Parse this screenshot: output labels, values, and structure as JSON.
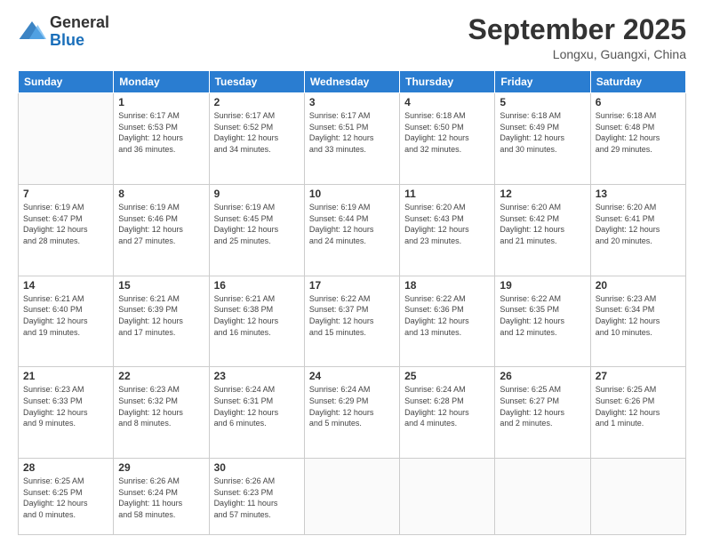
{
  "logo": {
    "general": "General",
    "blue": "Blue"
  },
  "header": {
    "month": "September 2025",
    "location": "Longxu, Guangxi, China"
  },
  "weekdays": [
    "Sunday",
    "Monday",
    "Tuesday",
    "Wednesday",
    "Thursday",
    "Friday",
    "Saturday"
  ],
  "weeks": [
    [
      {
        "day": "",
        "info": ""
      },
      {
        "day": "1",
        "info": "Sunrise: 6:17 AM\nSunset: 6:53 PM\nDaylight: 12 hours\nand 36 minutes."
      },
      {
        "day": "2",
        "info": "Sunrise: 6:17 AM\nSunset: 6:52 PM\nDaylight: 12 hours\nand 34 minutes."
      },
      {
        "day": "3",
        "info": "Sunrise: 6:17 AM\nSunset: 6:51 PM\nDaylight: 12 hours\nand 33 minutes."
      },
      {
        "day": "4",
        "info": "Sunrise: 6:18 AM\nSunset: 6:50 PM\nDaylight: 12 hours\nand 32 minutes."
      },
      {
        "day": "5",
        "info": "Sunrise: 6:18 AM\nSunset: 6:49 PM\nDaylight: 12 hours\nand 30 minutes."
      },
      {
        "day": "6",
        "info": "Sunrise: 6:18 AM\nSunset: 6:48 PM\nDaylight: 12 hours\nand 29 minutes."
      }
    ],
    [
      {
        "day": "7",
        "info": "Sunrise: 6:19 AM\nSunset: 6:47 PM\nDaylight: 12 hours\nand 28 minutes."
      },
      {
        "day": "8",
        "info": "Sunrise: 6:19 AM\nSunset: 6:46 PM\nDaylight: 12 hours\nand 27 minutes."
      },
      {
        "day": "9",
        "info": "Sunrise: 6:19 AM\nSunset: 6:45 PM\nDaylight: 12 hours\nand 25 minutes."
      },
      {
        "day": "10",
        "info": "Sunrise: 6:19 AM\nSunset: 6:44 PM\nDaylight: 12 hours\nand 24 minutes."
      },
      {
        "day": "11",
        "info": "Sunrise: 6:20 AM\nSunset: 6:43 PM\nDaylight: 12 hours\nand 23 minutes."
      },
      {
        "day": "12",
        "info": "Sunrise: 6:20 AM\nSunset: 6:42 PM\nDaylight: 12 hours\nand 21 minutes."
      },
      {
        "day": "13",
        "info": "Sunrise: 6:20 AM\nSunset: 6:41 PM\nDaylight: 12 hours\nand 20 minutes."
      }
    ],
    [
      {
        "day": "14",
        "info": "Sunrise: 6:21 AM\nSunset: 6:40 PM\nDaylight: 12 hours\nand 19 minutes."
      },
      {
        "day": "15",
        "info": "Sunrise: 6:21 AM\nSunset: 6:39 PM\nDaylight: 12 hours\nand 17 minutes."
      },
      {
        "day": "16",
        "info": "Sunrise: 6:21 AM\nSunset: 6:38 PM\nDaylight: 12 hours\nand 16 minutes."
      },
      {
        "day": "17",
        "info": "Sunrise: 6:22 AM\nSunset: 6:37 PM\nDaylight: 12 hours\nand 15 minutes."
      },
      {
        "day": "18",
        "info": "Sunrise: 6:22 AM\nSunset: 6:36 PM\nDaylight: 12 hours\nand 13 minutes."
      },
      {
        "day": "19",
        "info": "Sunrise: 6:22 AM\nSunset: 6:35 PM\nDaylight: 12 hours\nand 12 minutes."
      },
      {
        "day": "20",
        "info": "Sunrise: 6:23 AM\nSunset: 6:34 PM\nDaylight: 12 hours\nand 10 minutes."
      }
    ],
    [
      {
        "day": "21",
        "info": "Sunrise: 6:23 AM\nSunset: 6:33 PM\nDaylight: 12 hours\nand 9 minutes."
      },
      {
        "day": "22",
        "info": "Sunrise: 6:23 AM\nSunset: 6:32 PM\nDaylight: 12 hours\nand 8 minutes."
      },
      {
        "day": "23",
        "info": "Sunrise: 6:24 AM\nSunset: 6:31 PM\nDaylight: 12 hours\nand 6 minutes."
      },
      {
        "day": "24",
        "info": "Sunrise: 6:24 AM\nSunset: 6:29 PM\nDaylight: 12 hours\nand 5 minutes."
      },
      {
        "day": "25",
        "info": "Sunrise: 6:24 AM\nSunset: 6:28 PM\nDaylight: 12 hours\nand 4 minutes."
      },
      {
        "day": "26",
        "info": "Sunrise: 6:25 AM\nSunset: 6:27 PM\nDaylight: 12 hours\nand 2 minutes."
      },
      {
        "day": "27",
        "info": "Sunrise: 6:25 AM\nSunset: 6:26 PM\nDaylight: 12 hours\nand 1 minute."
      }
    ],
    [
      {
        "day": "28",
        "info": "Sunrise: 6:25 AM\nSunset: 6:25 PM\nDaylight: 12 hours\nand 0 minutes."
      },
      {
        "day": "29",
        "info": "Sunrise: 6:26 AM\nSunset: 6:24 PM\nDaylight: 11 hours\nand 58 minutes."
      },
      {
        "day": "30",
        "info": "Sunrise: 6:26 AM\nSunset: 6:23 PM\nDaylight: 11 hours\nand 57 minutes."
      },
      {
        "day": "",
        "info": ""
      },
      {
        "day": "",
        "info": ""
      },
      {
        "day": "",
        "info": ""
      },
      {
        "day": "",
        "info": ""
      }
    ]
  ]
}
